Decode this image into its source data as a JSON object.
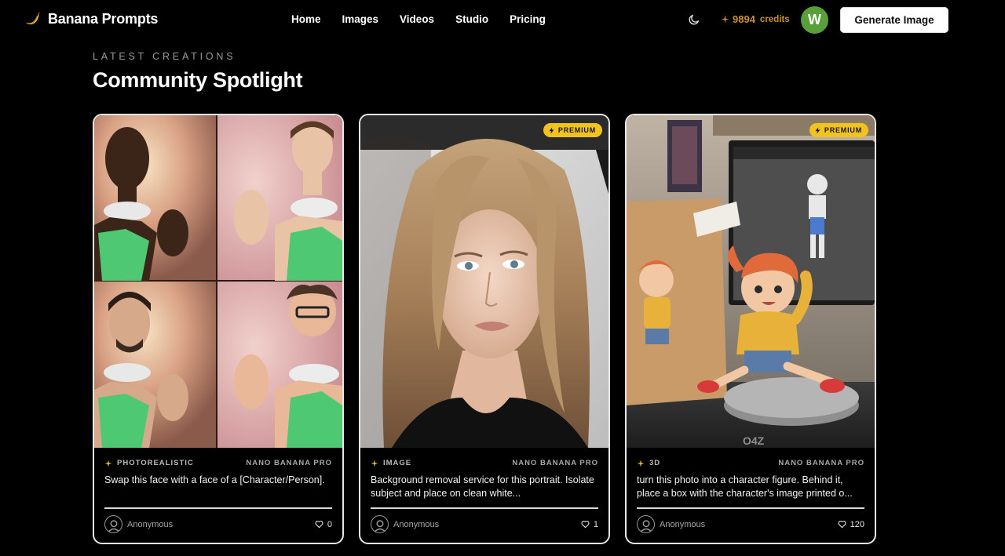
{
  "brand": {
    "name": "Banana Prompts",
    "icon": "banana-icon"
  },
  "nav": [
    {
      "label": "Home"
    },
    {
      "label": "Images"
    },
    {
      "label": "Videos"
    },
    {
      "label": "Studio"
    },
    {
      "label": "Pricing"
    }
  ],
  "header": {
    "theme_icon": "moon-icon",
    "credits_value": "9894",
    "credits_label": "credits",
    "avatar_initial": "W",
    "generate_label": "Generate Image"
  },
  "colors": {
    "accent": "#c8912b",
    "premium": "#f2c21f",
    "avatar_bg": "#5aa03a"
  },
  "section": {
    "eyebrow": "LATEST CREATIONS",
    "title": "Community Spotlight"
  },
  "cards": [
    {
      "premium": false,
      "image": "face-swap-collage",
      "category": "PHOTOREALISTIC",
      "model": "NANO BANANA PRO",
      "prompt": "Swap this face with a face of a [Character/Person].",
      "author": "Anonymous",
      "likes": "0"
    },
    {
      "premium": true,
      "premium_label": "PREMIUM",
      "image": "blonde-portrait",
      "category": "IMAGE",
      "model": "NANO BANANA PRO",
      "prompt": "Background removal service for this portrait. Isolate subject and place on clean white...",
      "author": "Anonymous",
      "likes": "1"
    },
    {
      "premium": true,
      "premium_label": "PREMIUM",
      "image": "anime-figure-on-desk",
      "category": "3D",
      "model": "NANO BANANA PRO",
      "prompt": "turn this photo into a character figure. Behind it, place a box with the character's image printed o...",
      "author": "Anonymous",
      "likes": "120"
    }
  ]
}
